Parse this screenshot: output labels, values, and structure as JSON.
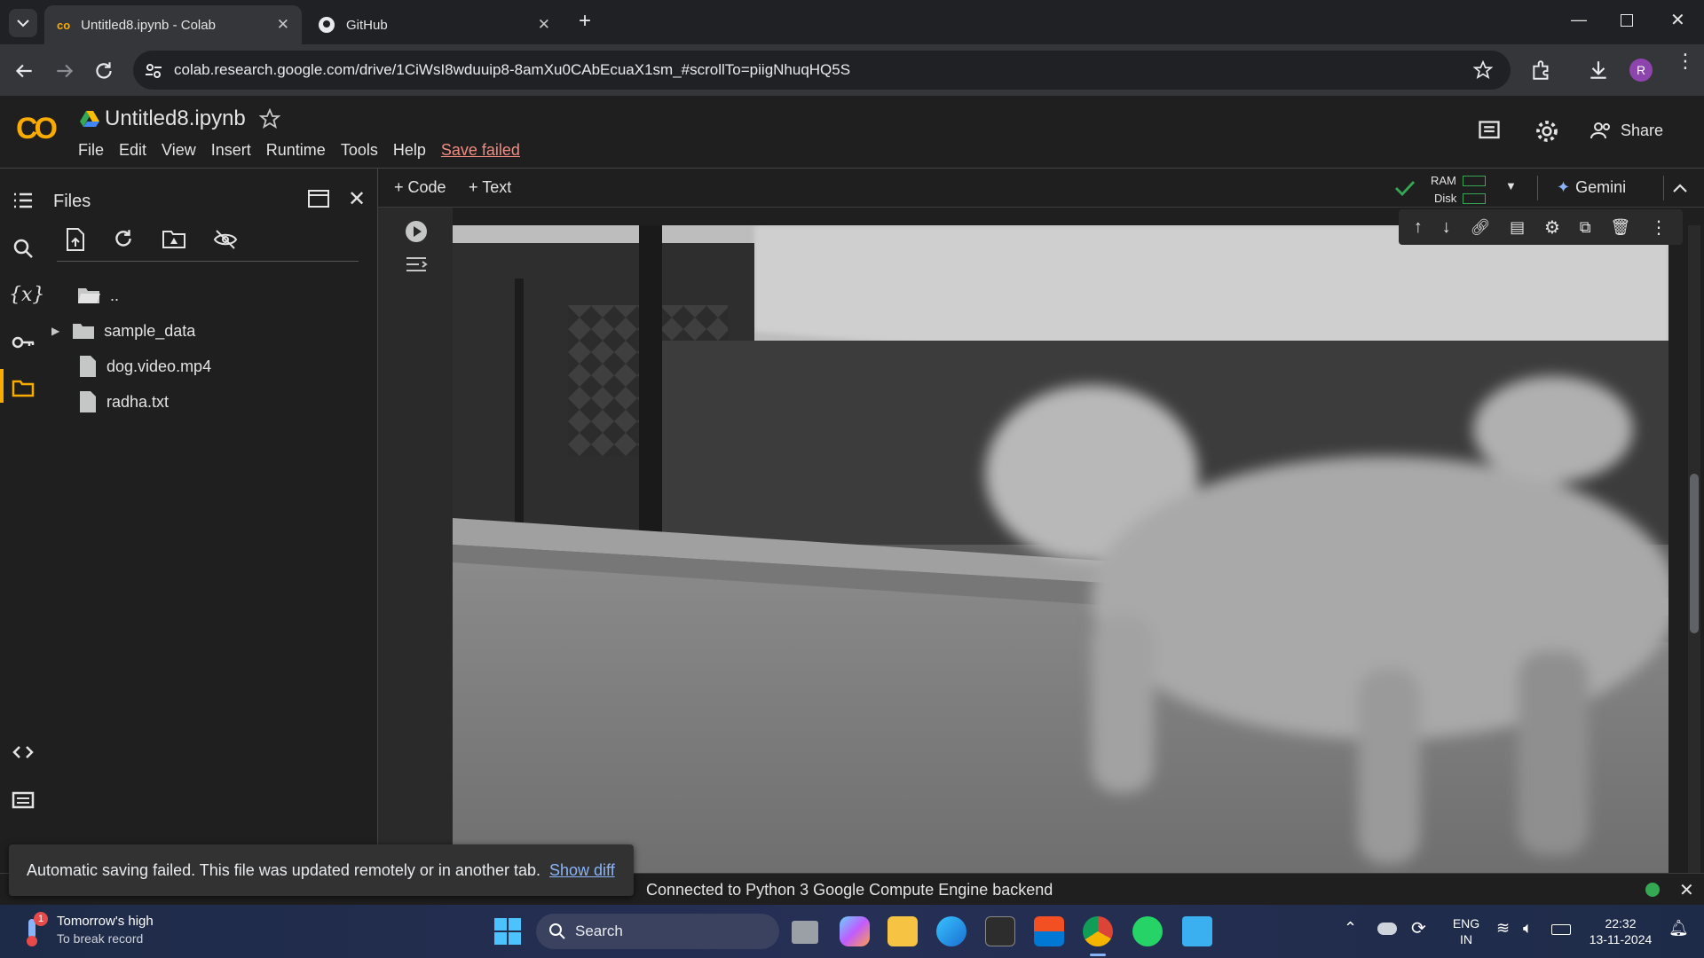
{
  "browser": {
    "tabs": [
      {
        "title": "Untitled8.ipynb - Colab",
        "active": true
      },
      {
        "title": "GitHub",
        "active": false
      }
    ],
    "url": "colab.research.google.com/drive/1CiWsI8wduuip8-8amXu0CAbEcuaX1sm_#scrollTo=piigNhuqHQ5S",
    "profile_initial": "R"
  },
  "colab": {
    "logo": "CO",
    "notebook_title": "Untitled8.ipynb",
    "menu": [
      "File",
      "Edit",
      "View",
      "Insert",
      "Runtime",
      "Tools",
      "Help"
    ],
    "save_status": "Save failed",
    "share_label": "Share",
    "toolbar": {
      "code_label": "+ Code",
      "text_label": "+ Text",
      "ram_label": "RAM",
      "disk_label": "Disk",
      "gemini_label": "Gemini"
    },
    "files_panel": {
      "title": "Files",
      "items": [
        {
          "name": "..",
          "type": "folder-open"
        },
        {
          "name": "sample_data",
          "type": "folder"
        },
        {
          "name": "dog.video.mp4",
          "type": "file"
        },
        {
          "name": "radha.txt",
          "type": "file"
        }
      ]
    },
    "status_text": "Connected to Python 3 Google Compute Engine backend",
    "toast": {
      "message": "Automatic saving failed. This file was updated remotely or in another tab.",
      "link": "Show diff"
    }
  },
  "taskbar": {
    "weather_line1": "Tomorrow's high",
    "weather_line2": "To break record",
    "weather_badge": "1",
    "search_label": "Search",
    "lang_line1": "ENG",
    "lang_line2": "IN",
    "time": "22:32",
    "date": "13-11-2024"
  },
  "colors": {
    "accent_orange": "#f9ab00",
    "save_failed": "#f28b82",
    "link_blue": "#8ab4f8",
    "connected_green": "#1e8e3e"
  }
}
